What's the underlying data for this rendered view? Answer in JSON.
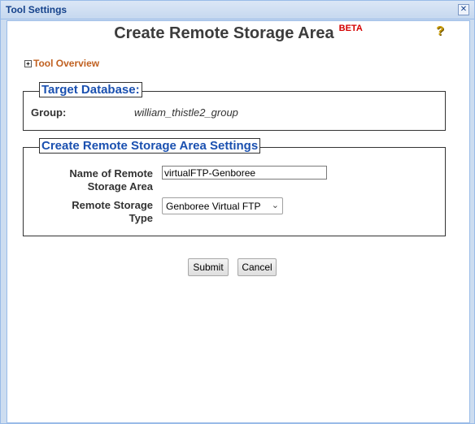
{
  "window": {
    "title": "Tool Settings",
    "close_label": "✕"
  },
  "header": {
    "title": "Create Remote Storage Area",
    "badge": "BETA",
    "help_icon": "?"
  },
  "overview": {
    "toggle": "+",
    "label": "Tool Overview"
  },
  "target_db": {
    "legend": "Target Database:",
    "group_label": "Group:",
    "group_value": "william_thistle2_group"
  },
  "settings": {
    "legend": "Create Remote Storage Area Settings",
    "name_label": "Name of Remote Storage Area",
    "name_value": "virtualFTP-Genboree",
    "type_label": "Remote Storage Type",
    "type_value": "Genboree Virtual FTP"
  },
  "buttons": {
    "submit": "Submit",
    "cancel": "Cancel"
  }
}
